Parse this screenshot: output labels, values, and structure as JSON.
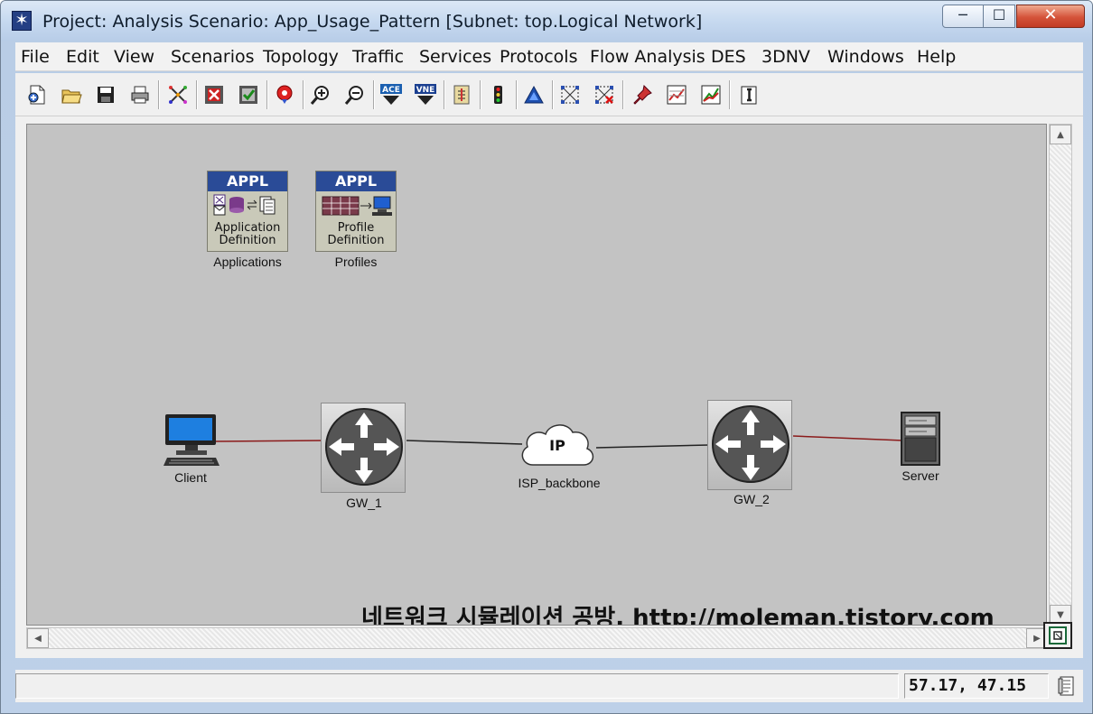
{
  "window": {
    "title": "Project: Analysis Scenario: App_Usage_Pattern  [Subnet: top.Logical Network]",
    "controls": {
      "minimize": "─",
      "maximize": "☐",
      "close": "✕"
    }
  },
  "menu": [
    {
      "label": "File"
    },
    {
      "label": "Edit"
    },
    {
      "label": "View"
    },
    {
      "label": "Scenarios"
    },
    {
      "label": "Topology"
    },
    {
      "label": "Traffic"
    },
    {
      "label": "Services"
    },
    {
      "label": "Protocols"
    },
    {
      "label": "Flow Analysis"
    },
    {
      "label": "DES"
    },
    {
      "label": "3DNV"
    },
    {
      "label": "Windows"
    },
    {
      "label": "Help"
    }
  ],
  "toolbar": {
    "ace_label": "ACE",
    "vne_label": "VNE",
    "buttons": [
      "new-icon",
      "open-folder-icon",
      "save-icon",
      "print-icon",
      "configure-icon",
      "fail-node-icon",
      "recover-node-icon",
      "marker-icon",
      "zoom-in-icon",
      "zoom-out-icon",
      "ace-icon",
      "vne-icon",
      "import-icon",
      "traffic-light-icon",
      "triangle-icon",
      "select-links-icon",
      "fail-links-icon",
      "pin-icon",
      "graph-icon",
      "results-icon",
      "info-icon"
    ]
  },
  "canvas": {
    "background": "#c3c3c3",
    "objects": {
      "applications": {
        "header": "APPL",
        "caption_line1": "Application",
        "caption_line2": "Definition",
        "label": "Applications"
      },
      "profiles": {
        "header": "APPL",
        "caption_line1": "Profile",
        "caption_line2": "Definition",
        "label": "Profiles"
      },
      "client": {
        "label": "Client"
      },
      "gw1": {
        "label": "GW_1"
      },
      "isp": {
        "cloud_text": "IP",
        "label": "ISP_backbone"
      },
      "gw2": {
        "label": "GW_2"
      },
      "server": {
        "label": "Server"
      }
    },
    "link_colors": {
      "access": "#8b1a1a",
      "backbone": "#222222"
    },
    "watermark": "네트워크 시뮬레이션 공방, http://moleman.tistory.com"
  },
  "status": {
    "message": "",
    "coordinates": "57.17, 47.15"
  }
}
